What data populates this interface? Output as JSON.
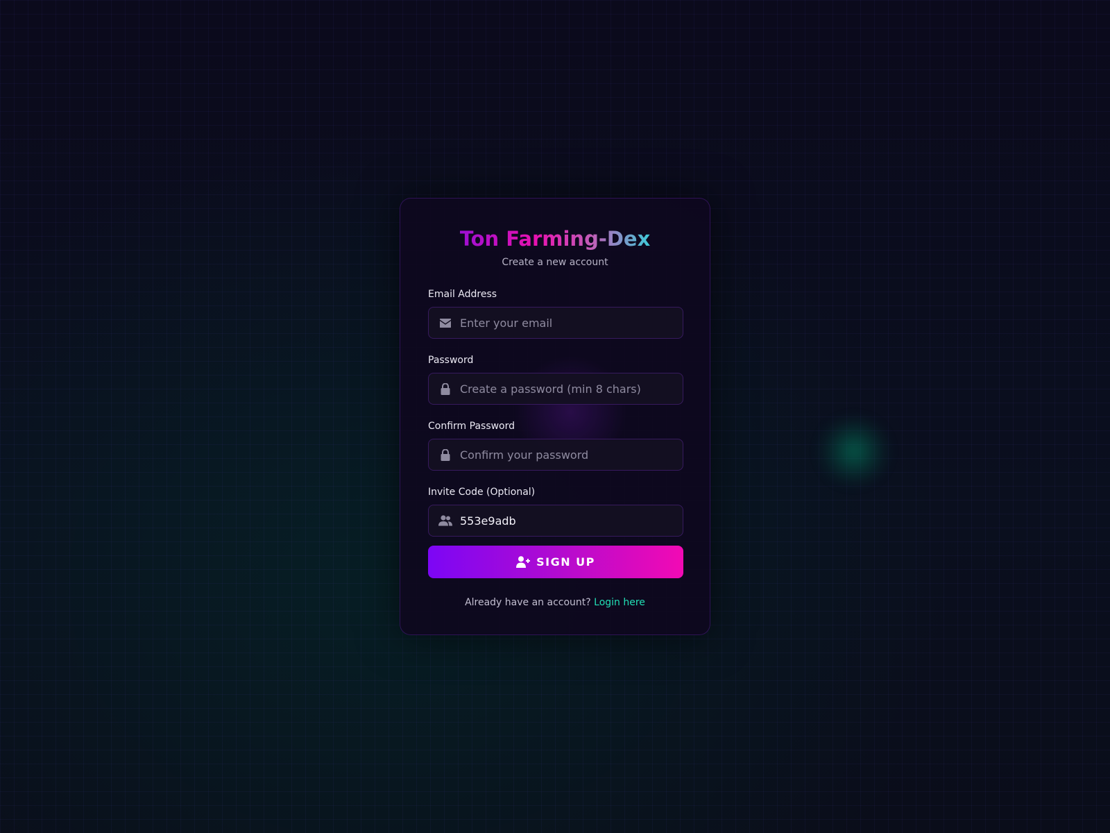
{
  "brand": {
    "title": "Ton Farming-Dex",
    "subtitle": "Create a new account"
  },
  "form": {
    "email": {
      "label": "Email Address",
      "placeholder": "Enter your email",
      "value": "",
      "icon": "envelope-icon"
    },
    "password": {
      "label": "Password",
      "placeholder": "Create a password (min 8 chars)",
      "value": "",
      "icon": "lock-icon"
    },
    "confirm_password": {
      "label": "Confirm Password",
      "placeholder": "Confirm your password",
      "value": "",
      "icon": "lock-icon"
    },
    "invite_code": {
      "label": "Invite Code (Optional)",
      "placeholder": "",
      "value": "553e9adb",
      "icon": "users-icon"
    },
    "submit": {
      "label": "SIGN UP",
      "icon": "user-plus-icon"
    }
  },
  "footer": {
    "prompt": "Already have an account?",
    "link_label": "Login here"
  },
  "colors": {
    "accent_purple": "#7c06f5",
    "accent_pink": "#f20ab4",
    "link_teal": "#22e0b6",
    "background": "#0a0a18"
  }
}
